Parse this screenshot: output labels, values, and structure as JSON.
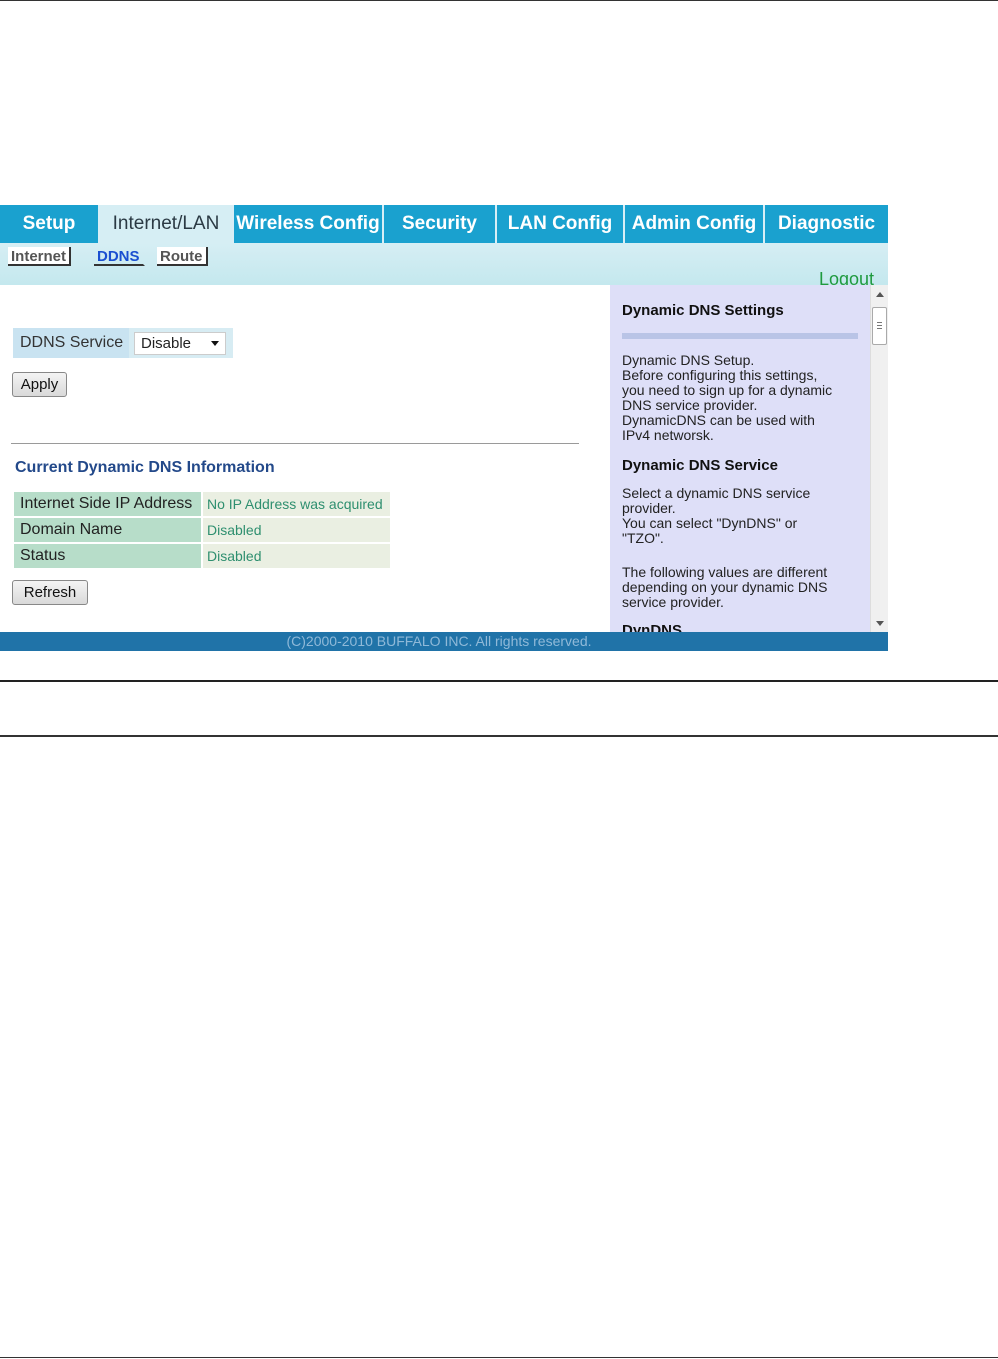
{
  "nav": {
    "tabs": [
      {
        "label": "Setup",
        "active": false
      },
      {
        "label": "Internet/LAN",
        "active": true
      },
      {
        "label": "Wireless Config",
        "active": false
      },
      {
        "label": "Security",
        "active": false
      },
      {
        "label": "LAN Config",
        "active": false
      },
      {
        "label": "Admin Config",
        "active": false
      },
      {
        "label": "Diagnostic",
        "active": false
      }
    ],
    "subtabs": [
      {
        "label": "Internet",
        "active": false
      },
      {
        "label": "DDNS",
        "active": true
      },
      {
        "label": "Route",
        "active": false
      }
    ],
    "logout": "Logout"
  },
  "form": {
    "ddns_label": "DDNS Service",
    "ddns_value": "Disable",
    "apply": "Apply"
  },
  "info": {
    "title": "Current Dynamic DNS Information",
    "rows": [
      {
        "label": "Internet Side IP Address",
        "value": "No IP Address was acquired"
      },
      {
        "label": "Domain Name",
        "value": "Disabled"
      },
      {
        "label": "Status",
        "value": "Disabled"
      }
    ],
    "refresh": "Refresh"
  },
  "help": {
    "title": "Dynamic DNS Settings",
    "intro": [
      "Dynamic DNS Setup.",
      "Before configuring this settings,",
      "you need to sign up for a dynamic",
      "DNS service provider.",
      "DynamicDNS can be used with",
      "IPv4 networsk."
    ],
    "service_title": "Dynamic DNS Service",
    "service_text": [
      "Select a dynamic DNS service",
      "provider.",
      "You can select \"DynDNS\" or",
      "\"TZO\"."
    ],
    "values_text": [
      "The following values are different",
      "depending on your dynamic DNS",
      "service provider."
    ],
    "next_title": "DynDNS"
  },
  "footer": "(C)2000-2010 BUFFALO INC. All rights reserved.",
  "colors": {
    "tab_bar": "#1aa1cf",
    "active_tab": "#d6eef4",
    "logout": "#1f9a3f",
    "help_bg": "#dedff8",
    "footer": "#2073a8"
  }
}
